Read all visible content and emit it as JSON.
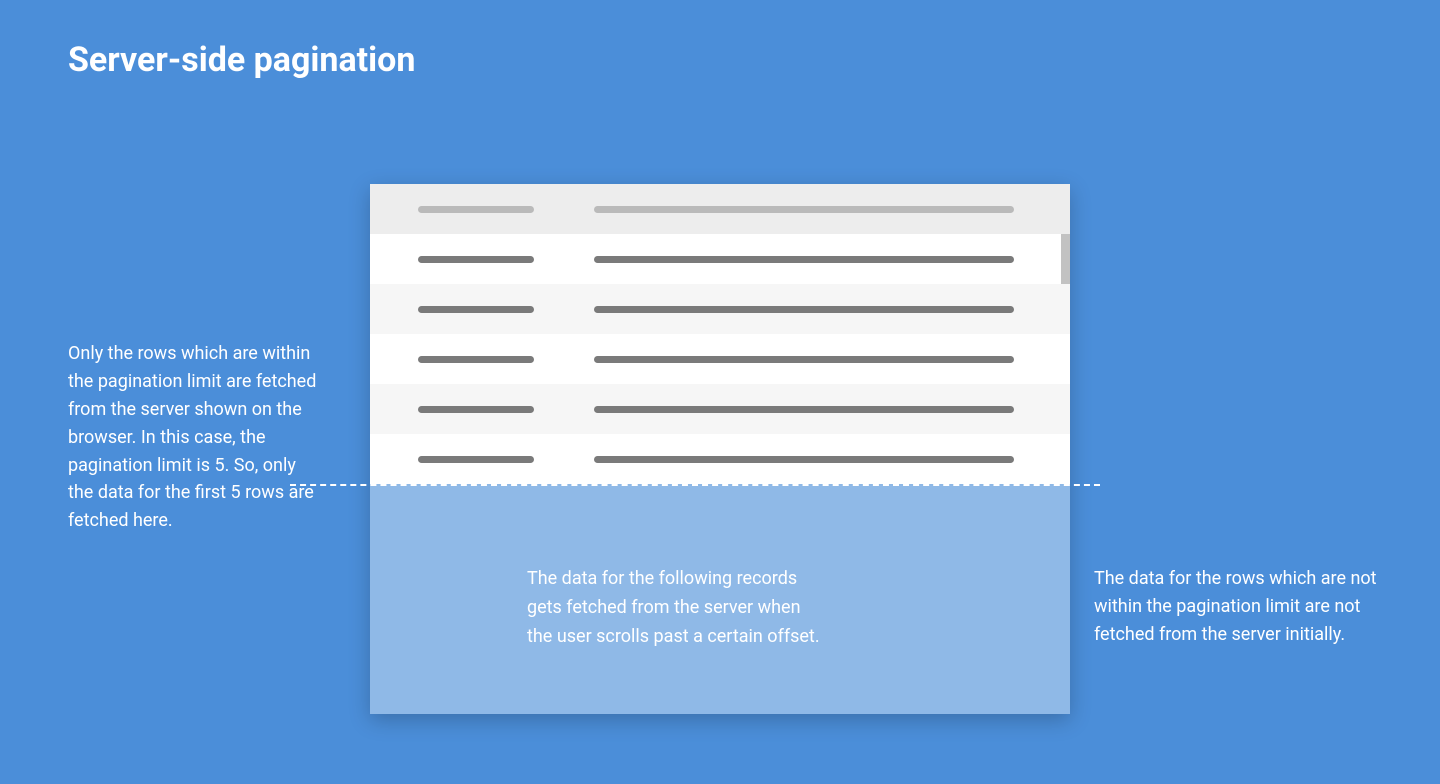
{
  "title": "Server-side pagination",
  "captions": {
    "left": "Only the rows which are within the pagination limit are fetched from the server shown on the browser. In this case, the pagination limit is 5. So, only the data for the first 5 rows are fetched here.",
    "center": "The data for the following records gets fetched from the server when the user scrolls past a certain offset.",
    "right": "The data for the rows which are not within the pagination limit are not fetched from the server initially."
  },
  "diagram": {
    "pagination_limit": 5,
    "visible_rows": 5,
    "header_placeholder": true
  }
}
